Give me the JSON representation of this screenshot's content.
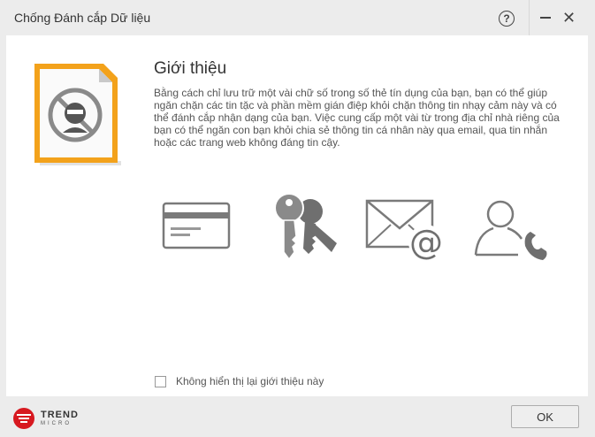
{
  "window": {
    "title": "Chống Đánh cắp Dữ liệu",
    "help_label": "?",
    "close_label": "✕"
  },
  "intro": {
    "heading": "Giới thiệu",
    "description": "Bằng cách chỉ lưu trữ một vài chữ số trong số thẻ tín dụng của bạn, bạn có thể giúp ngăn chặn các tin tặc và phần mềm gián điệp khỏi chặn thông tin nhạy cảm này và có thể đánh cắp nhận dạng của bạn. Việc cung cấp một vài từ trong địa chỉ nhà riêng của bạn có thể ngăn con bạn khỏi chia sẻ thông tin cá nhân này qua email, qua tin nhắn hoặc các trang web không đáng tin cậy."
  },
  "icons": [
    "data-theft-document-icon",
    "credit-card-icon",
    "keys-icon",
    "email-at-icon",
    "contact-phone-icon"
  ],
  "checkbox": {
    "label": "Không hiển thị lại giới thiệu này",
    "checked": false
  },
  "footer": {
    "brand_top": "TREND",
    "brand_bottom": "MICRO",
    "ok_label": "OK"
  },
  "colors": {
    "accent_orange": "#f3a21b",
    "brand_red": "#d71920",
    "icon_gray": "#7a7a7a"
  }
}
